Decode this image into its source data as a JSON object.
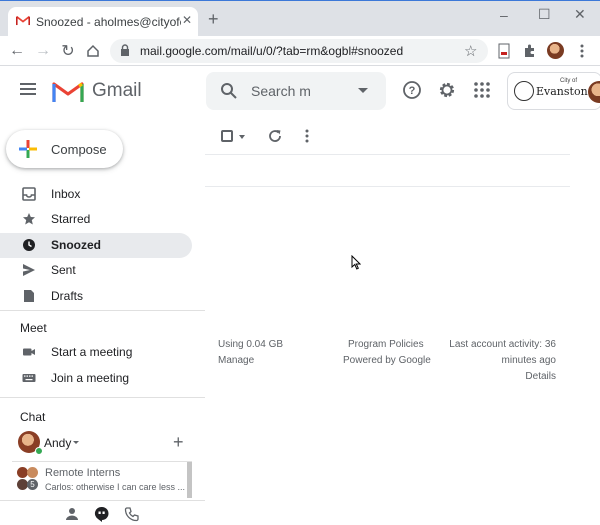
{
  "browser": {
    "tab_title": "Snoozed - aholmes@cityofevanston",
    "url": "mail.google.com/mail/u/0/?tab=rm&ogbl#snoozed",
    "icons": [
      "back-icon",
      "forward-icon",
      "reload-icon",
      "home-icon",
      "lock-icon",
      "bookmark-star-icon",
      "extensions-icon",
      "menu-kebab-icon"
    ]
  },
  "header": {
    "app_name": "Gmail",
    "search_placeholder": "Search mail",
    "org": {
      "small": "City of",
      "name": "Evanston"
    }
  },
  "sidebar": {
    "compose_label": "Compose",
    "items": [
      {
        "label": "Inbox",
        "icon": "inbox-icon",
        "active": false
      },
      {
        "label": "Starred",
        "icon": "star-icon",
        "active": false
      },
      {
        "label": "Snoozed",
        "icon": "clock-icon",
        "active": true
      },
      {
        "label": "Sent",
        "icon": "send-icon",
        "active": false
      },
      {
        "label": "Drafts",
        "icon": "draft-icon",
        "active": false
      }
    ],
    "meet": {
      "title": "Meet",
      "items": [
        {
          "label": "Start a meeting",
          "icon": "video-icon"
        },
        {
          "label": "Join a meeting",
          "icon": "keyboard-icon"
        }
      ]
    },
    "chat": {
      "title": "Chat",
      "user": "Andy",
      "room": {
        "name": "Remote Interns",
        "count": "5",
        "snippet": "Carlos: otherwise I can care less ..."
      }
    }
  },
  "footer": {
    "storage": "Using 0.04 GB",
    "manage": "Manage",
    "policies": "Program Policies",
    "powered": "Powered by Google",
    "activity_1": "Last account activity: 36",
    "activity_2": "minutes ago",
    "details": "Details"
  },
  "colors": {
    "gmail_red": "#ea4335",
    "active_nav": "#e8eaed",
    "presence": "#34a853"
  }
}
